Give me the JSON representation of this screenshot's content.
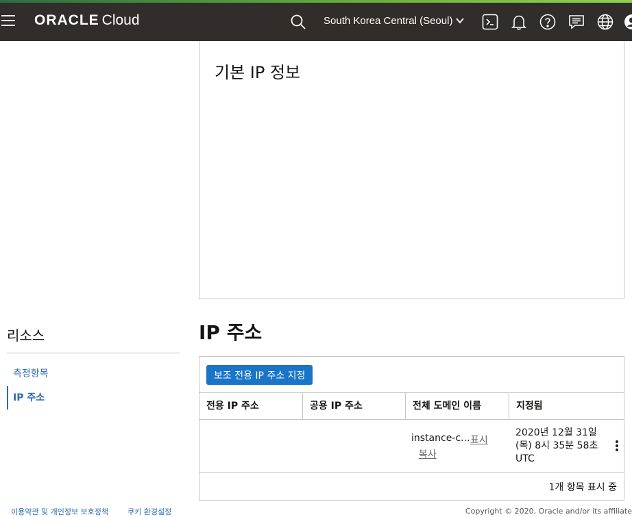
{
  "header": {
    "brand": "ORACLE",
    "product": "Cloud",
    "region": "South Korea Central (Seoul)",
    "icons": [
      "menu-icon",
      "search-icon",
      "chevron-down-icon",
      "cloud-shell-icon",
      "bell-icon",
      "help-icon",
      "chat-icon",
      "globe-icon",
      "profile-icon"
    ],
    "accent_colors": [
      "#2c6e3f",
      "#8fd14f"
    ],
    "background": "#312d2a"
  },
  "info_panel": {
    "title": "기본 IP 정보"
  },
  "resources": {
    "title": "리소스",
    "items": [
      {
        "label": "측정항목",
        "active": false
      },
      {
        "label": "IP 주소",
        "active": true
      }
    ]
  },
  "ip_section": {
    "title": "IP 주소",
    "assign_button": "보조 전용 IP 주소 지정",
    "button_color": "#1a74c7",
    "columns": [
      "전용 IP 주소",
      "공용 IP 주소",
      "전체 도메인 이름",
      "지정됨"
    ],
    "rows": [
      {
        "private_ip": "",
        "public_ip": "",
        "domain": "instance-c...",
        "show_link": "표시",
        "copy_link": "복사",
        "assigned": "2020년 12월 31일 (목) 8시 35분 58초 UTC"
      }
    ],
    "count_text": "1개 항목 표시 중"
  },
  "footer": {
    "terms": "이용약관 및 개인정보 보호정책",
    "cookies": "쿠키 환경설정",
    "copyright": "Copyright © 2020, Oracle and/or its affiliate"
  }
}
